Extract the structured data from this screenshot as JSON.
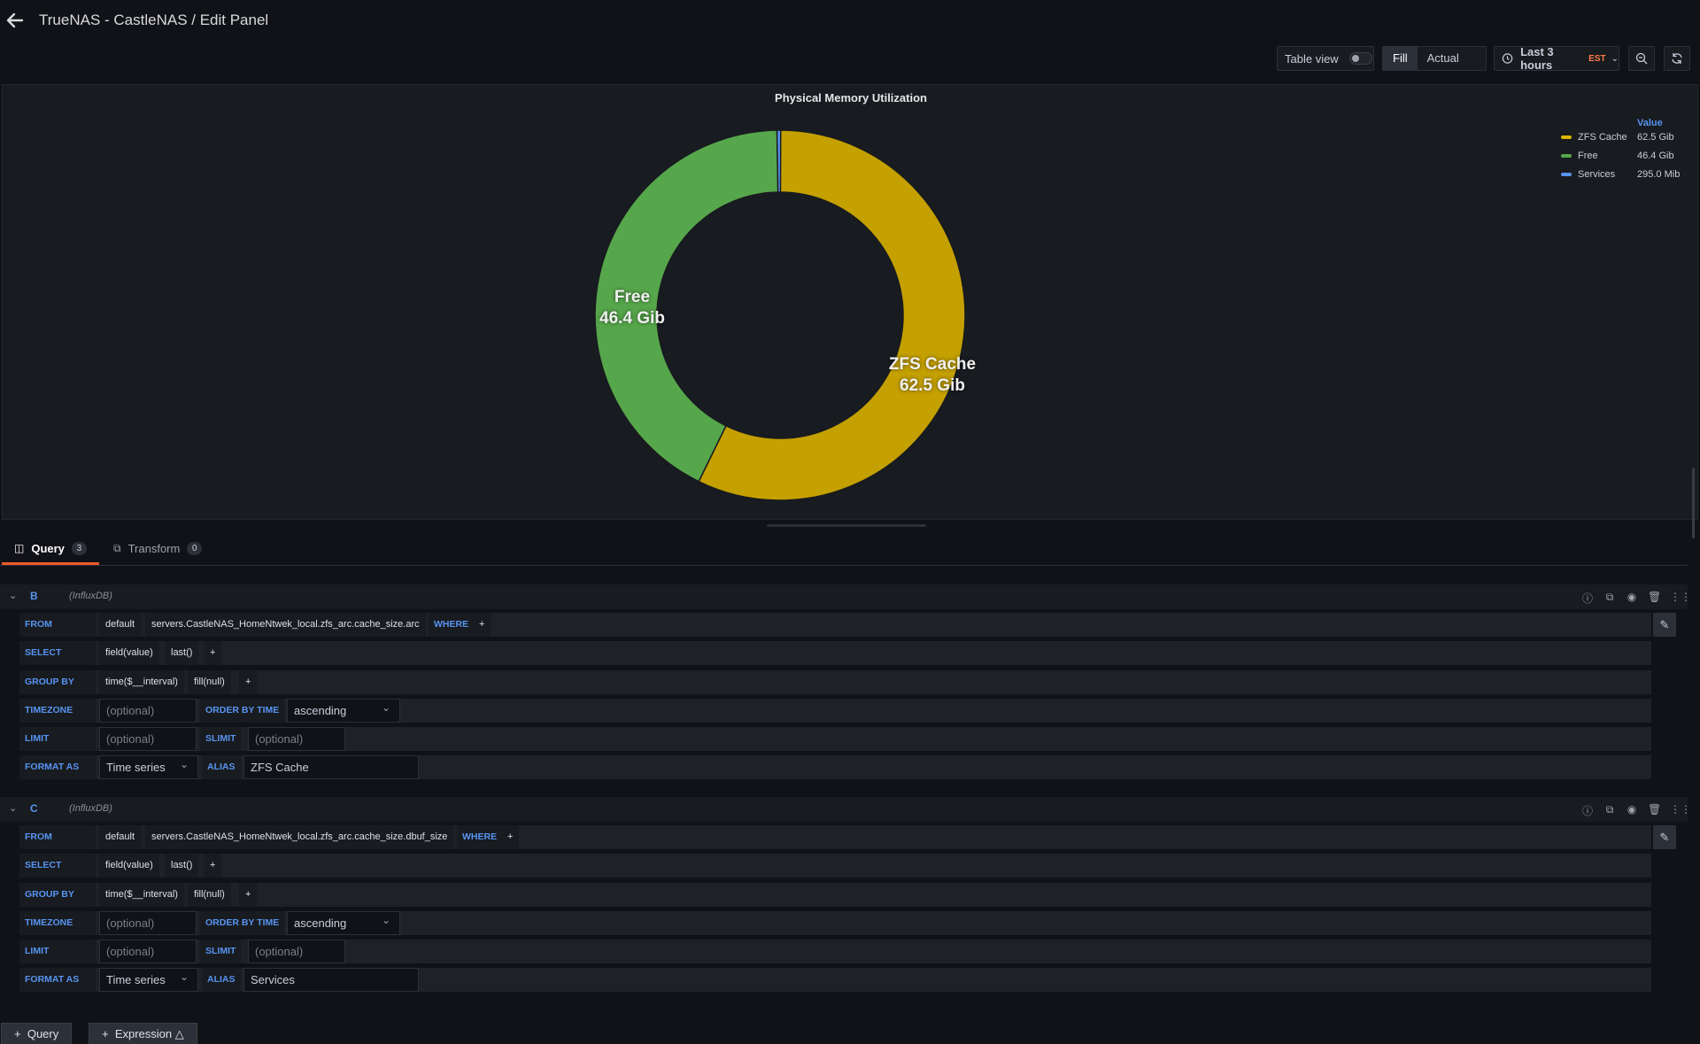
{
  "header": {
    "title": "TrueNAS - CastleNAS / Edit Panel",
    "table_view_label": "Table view",
    "fill_label": "Fill",
    "actual_label": "Actual",
    "time_range_label": "Last 3 hours",
    "timezone_badge": "EST"
  },
  "panel": {
    "title": "Physical Memory Utilization",
    "legend_header": "Value",
    "slice_labels": [
      {
        "name": "Free",
        "value": "46.4 Gib"
      },
      {
        "name": "ZFS Cache",
        "value": "62.5 Gib"
      }
    ]
  },
  "chart_data": {
    "type": "pie",
    "title": "Physical Memory Utilization",
    "series": [
      {
        "name": "ZFS Cache",
        "value": 62.5,
        "unit": "Gib",
        "display": "62.5 Gib",
        "color": "#c4a000"
      },
      {
        "name": "Free",
        "value": 46.4,
        "unit": "Gib",
        "display": "46.4 Gib",
        "color": "#56a64b"
      },
      {
        "name": "Services",
        "value": 0.288,
        "unit": "Gib",
        "display": "295.0 Mib",
        "color": "#5794f2"
      }
    ],
    "legend_placement": "top-right"
  },
  "tabs": {
    "query": {
      "label": "Query",
      "count": "3"
    },
    "transform": {
      "label": "Transform",
      "count": "0"
    }
  },
  "queries": [
    {
      "ref_id": "B",
      "datasource": "(InfluxDB)",
      "from_label": "FROM",
      "policy": "default",
      "measurement": "servers.CastleNAS_HomeNtwek_local.zfs_arc.cache_size.arc",
      "where_label": "WHERE",
      "plus": "+",
      "select_label": "SELECT",
      "select_field": "field(value)",
      "select_fn": "last()",
      "group_by_label": "GROUP BY",
      "group_time": "time($__interval)",
      "group_fill": "fill(null)",
      "timezone_label": "TIMEZONE",
      "timezone_placeholder": "(optional)",
      "order_label": "ORDER BY TIME",
      "order_value": "ascending",
      "limit_label": "LIMIT",
      "limit_placeholder": "(optional)",
      "slimit_label": "SLIMIT",
      "slimit_placeholder": "(optional)",
      "format_label": "FORMAT AS",
      "format_value": "Time series",
      "alias_label": "ALIAS",
      "alias_value": "ZFS Cache"
    },
    {
      "ref_id": "C",
      "datasource": "(InfluxDB)",
      "from_label": "FROM",
      "policy": "default",
      "measurement": "servers.CastleNAS_HomeNtwek_local.zfs_arc.cache_size.dbuf_size",
      "where_label": "WHERE",
      "plus": "+",
      "select_label": "SELECT",
      "select_field": "field(value)",
      "select_fn": "last()",
      "group_by_label": "GROUP BY",
      "group_time": "time($__interval)",
      "group_fill": "fill(null)",
      "timezone_label": "TIMEZONE",
      "timezone_placeholder": "(optional)",
      "order_label": "ORDER BY TIME",
      "order_value": "ascending",
      "limit_label": "LIMIT",
      "limit_placeholder": "(optional)",
      "slimit_label": "SLIMIT",
      "slimit_placeholder": "(optional)",
      "format_label": "FORMAT AS",
      "format_value": "Time series",
      "alias_label": "ALIAS",
      "alias_value": "Services"
    }
  ],
  "footer": {
    "add_query_label": "Query",
    "add_expression_label": "Expression"
  },
  "colors": {
    "accent": "#f05a28",
    "keyword": "#5794f2",
    "background": "#111217",
    "panel": "#181b1f"
  }
}
